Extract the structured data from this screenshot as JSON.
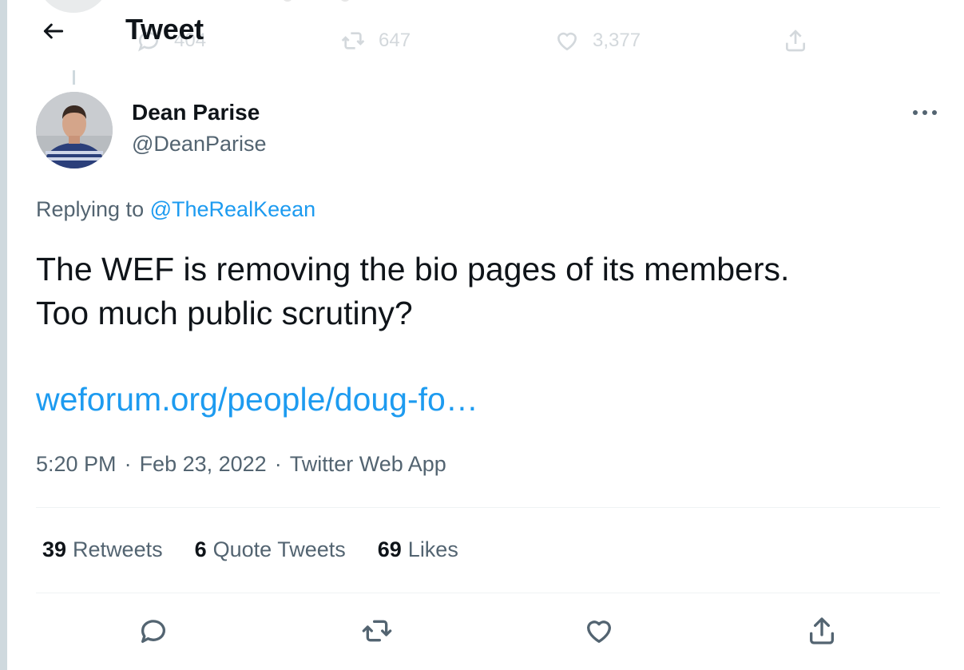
{
  "parent_tweet": {
    "reply_count": "404",
    "retweet_count": "647",
    "like_count": "3,377"
  },
  "header": {
    "back_icon": "arrow-left-icon",
    "title": "Tweet"
  },
  "author": {
    "display_name": "Dean Parise",
    "handle": "@DeanParise",
    "avatar_icon": "user-photo"
  },
  "more_icon": "ellipsis-icon",
  "reply_context": {
    "prefix": "Replying to",
    "target": "@TheRealKeean"
  },
  "tweet": {
    "text_line1": "The WEF is removing the bio pages of its members.",
    "text_line2": "Too much public scrutiny?",
    "link": "weforum.org/people/doug-fo…",
    "time": "5:20 PM",
    "date": "Feb 23, 2022",
    "source": "Twitter Web App",
    "separator": "·"
  },
  "stats": {
    "retweets_count": "39",
    "retweets_label": "Retweets",
    "quotes_count": "6",
    "quotes_label": "Quote Tweets",
    "likes_count": "69",
    "likes_label": "Likes"
  },
  "actions": [
    "reply-icon",
    "retweet-icon",
    "like-icon",
    "share-icon"
  ],
  "colors": {
    "accent": "#1d9bf0",
    "text_primary": "#0f1419",
    "text_secondary": "#536471",
    "divider": "#eff3f4"
  }
}
